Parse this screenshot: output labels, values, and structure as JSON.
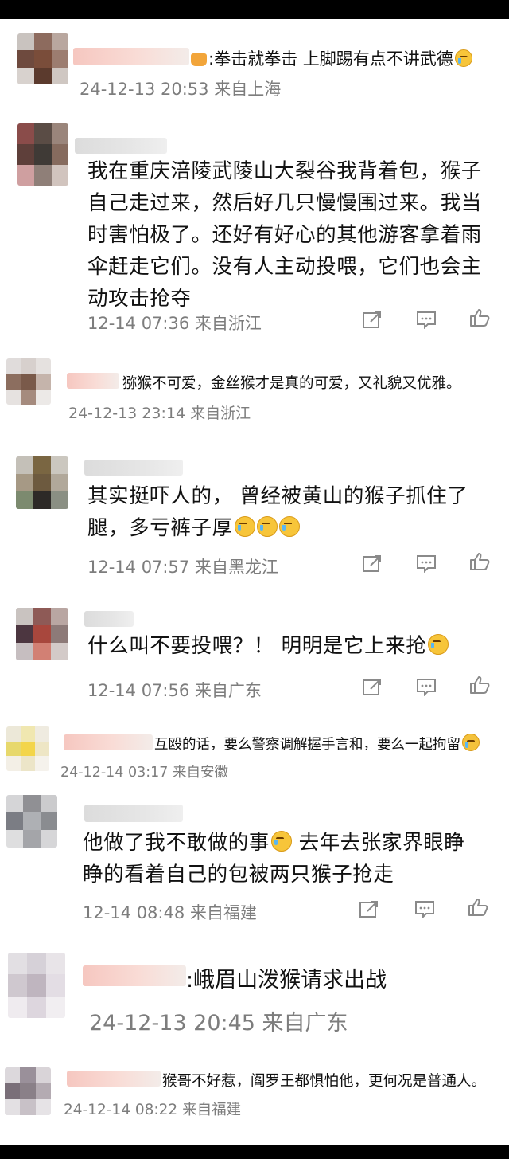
{
  "colors": {
    "text": "#111111",
    "meta": "#7d7d7d",
    "icon": "#8a8a8a",
    "emoji": "#f7c53a"
  },
  "comments": [
    {
      "prefix": ":",
      "text": "拳击就拳击 上脚踢有点不讲武德",
      "time": "24-12-13 20:53",
      "location": "来自上海",
      "emoji": "doge-cry"
    },
    {
      "body_lines": [
        "我在重庆涪陵武陵山大裂谷我背着包，猴子",
        "自己走过来，然后好几只慢慢围过来。我当",
        "时害怕极了。还好有好心的其他游客拿着雨",
        "伞赶走它们。没有人主动投喂，它们也会主",
        "动攻击抢夺"
      ],
      "time": "12-14 07:36",
      "location": "来自浙江"
    },
    {
      "text": "猕猴不可爱，金丝猴才是真的可爱，又礼貌又优雅。",
      "time": "24-12-13 23:14",
      "location": "来自浙江"
    },
    {
      "body_lines": [
        "其实挺吓人的， 曾经被黄山的猴子抓住了",
        "腿，多亏裤子厚"
      ],
      "time": "12-14 07:57",
      "location": "来自黑龙江"
    },
    {
      "body_lines": [
        "什么叫不要投喂？！ 明明是它上来抢"
      ],
      "time": "12-14 07:56",
      "location": "来自广东"
    },
    {
      "text": "互殴的话，要么警察调解握手言和，要么一起拘留",
      "time": "24-12-14 03:17",
      "location": "来自安徽"
    },
    {
      "body_lines": [
        "他做了我不敢做的事",
        " 去年去张家界眼睁",
        "睁的看着自己的包被两只猴子抢走"
      ],
      "time": "12-14 08:48",
      "location": "来自福建"
    },
    {
      "prefix": ":",
      "text": "峨眉山泼猴请求出战",
      "time": "24-12-13 20:45",
      "location": "来自广东"
    },
    {
      "text": "猴哥不好惹，阎罗王都惧怕他，更何况是普通人。",
      "time": "24-12-14 08:22",
      "location": "来自福建"
    }
  ],
  "actions": {
    "share_icon": "share-icon",
    "comment_icon": "comment-icon",
    "like_icon": "like-icon"
  }
}
